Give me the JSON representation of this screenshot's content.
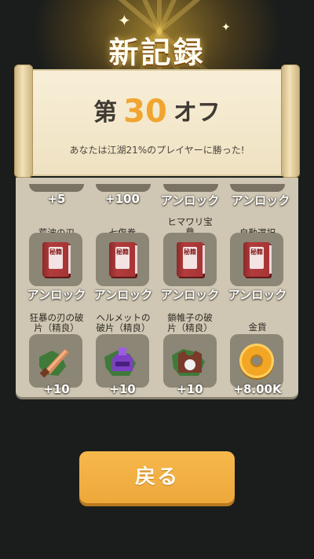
{
  "header": {
    "title": "新記録"
  },
  "result": {
    "rank_prefix": "第",
    "rank_number": "30",
    "rank_suffix": "オフ",
    "subtitle": "あなたは江湖21%のプレイヤーに勝った!"
  },
  "rewards": {
    "row1": [
      "+5",
      "+100",
      "アンロック",
      "アンロック"
    ],
    "row2": [
      {
        "name": "荒波の刃",
        "value": "アンロック",
        "icon": "red-book-icon",
        "tag": "秘籍"
      },
      {
        "name": "七傷拳",
        "value": "アンロック",
        "icon": "red-book-icon",
        "tag": "秘籍"
      },
      {
        "name": "ヒマワリ宝典",
        "name_lines": [
          "ヒマワリ宝",
          "典"
        ],
        "value": "アンロック",
        "icon": "red-book-icon",
        "tag": "秘籍"
      },
      {
        "name": "自動選択",
        "value": "アンロック",
        "icon": "red-book-icon",
        "tag": "秘籍"
      }
    ],
    "row3": [
      {
        "name_lines": [
          "狂暴の刃の破",
          "片（精良）"
        ],
        "value": "+10",
        "icon": "sword-fragment-icon"
      },
      {
        "name_lines": [
          "ヘルメットの",
          "破片（精良）"
        ],
        "value": "+10",
        "icon": "helmet-fragment-icon"
      },
      {
        "name_lines": [
          "鎖帷子の破",
          "片（精良）"
        ],
        "value": "+10",
        "icon": "chainmail-fragment-icon"
      },
      {
        "name_lines": [
          "金貨"
        ],
        "value": "+8.00K",
        "icon": "gold-coin-icon"
      }
    ]
  },
  "footer": {
    "back_label": "戻る"
  },
  "colors": {
    "accent": "#f0a530",
    "button": "#eea83b",
    "panel": "#cfc7b3",
    "cell": "#8c8676"
  }
}
